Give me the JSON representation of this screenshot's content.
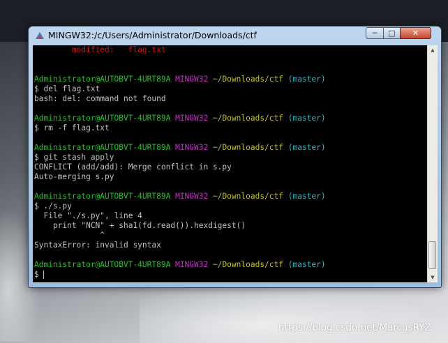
{
  "window": {
    "title": "MINGW32:/c/Users/Administrator/Downloads/ctf",
    "controls": {
      "minimize": "─",
      "maximize": "□",
      "close": "✕"
    }
  },
  "terminal": {
    "lines": [
      {
        "parts": [
          {
            "text": "        modified:   flag.txt",
            "color": "red"
          }
        ]
      },
      {
        "parts": []
      },
      {
        "parts": []
      },
      {
        "parts": [
          {
            "text": "Administrator@AUTOBVT-4URT89A ",
            "color": "green"
          },
          {
            "text": "MINGW32 ",
            "color": "magenta"
          },
          {
            "text": "~/Downloads/ctf ",
            "color": "yellow"
          },
          {
            "text": "(master)",
            "color": "cyan"
          }
        ]
      },
      {
        "parts": [
          {
            "text": "$ del flag.txt",
            "color": "white"
          }
        ]
      },
      {
        "parts": [
          {
            "text": "bash: del: command not found",
            "color": "white"
          }
        ]
      },
      {
        "parts": []
      },
      {
        "parts": [
          {
            "text": "Administrator@AUTOBVT-4URT89A ",
            "color": "green"
          },
          {
            "text": "MINGW32 ",
            "color": "magenta"
          },
          {
            "text": "~/Downloads/ctf ",
            "color": "yellow"
          },
          {
            "text": "(master)",
            "color": "cyan"
          }
        ]
      },
      {
        "parts": [
          {
            "text": "$ rm -f flag.txt",
            "color": "white"
          }
        ]
      },
      {
        "parts": []
      },
      {
        "parts": [
          {
            "text": "Administrator@AUTOBVT-4URT89A ",
            "color": "green"
          },
          {
            "text": "MINGW32 ",
            "color": "magenta"
          },
          {
            "text": "~/Downloads/ctf ",
            "color": "yellow"
          },
          {
            "text": "(master)",
            "color": "cyan"
          }
        ]
      },
      {
        "parts": [
          {
            "text": "$ git stash apply",
            "color": "white"
          }
        ]
      },
      {
        "parts": [
          {
            "text": "CONFLICT (add/add): Merge conflict in s.py",
            "color": "white"
          }
        ]
      },
      {
        "parts": [
          {
            "text": "Auto-merging s.py",
            "color": "white"
          }
        ]
      },
      {
        "parts": []
      },
      {
        "parts": [
          {
            "text": "Administrator@AUTOBVT-4URT89A ",
            "color": "green"
          },
          {
            "text": "MINGW32 ",
            "color": "magenta"
          },
          {
            "text": "~/Downloads/ctf ",
            "color": "yellow"
          },
          {
            "text": "(master)",
            "color": "cyan"
          }
        ]
      },
      {
        "parts": [
          {
            "text": "$ ./s.py",
            "color": "white"
          }
        ]
      },
      {
        "parts": [
          {
            "text": "  File \"./s.py\", line 4",
            "color": "white"
          }
        ]
      },
      {
        "parts": [
          {
            "text": "    print \"NCN\" + sha1(fd.read()).hexdigest()",
            "color": "white"
          }
        ]
      },
      {
        "parts": [
          {
            "text": "              ^",
            "color": "white"
          }
        ]
      },
      {
        "parts": [
          {
            "text": "SyntaxError: invalid syntax",
            "color": "white"
          }
        ]
      },
      {
        "parts": []
      },
      {
        "parts": [
          {
            "text": "Administrator@AUTOBVT-4URT89A ",
            "color": "green"
          },
          {
            "text": "MINGW32 ",
            "color": "magenta"
          },
          {
            "text": "~/Downloads/ctf ",
            "color": "yellow"
          },
          {
            "text": "(master)",
            "color": "cyan"
          }
        ]
      },
      {
        "parts": [
          {
            "text": "$ ",
            "color": "white"
          }
        ],
        "cursor": true
      }
    ]
  },
  "scrollbar": {
    "up": "▲",
    "down": "▼"
  },
  "watermark": "https://blog.csdn.net/MarcusRYZ"
}
